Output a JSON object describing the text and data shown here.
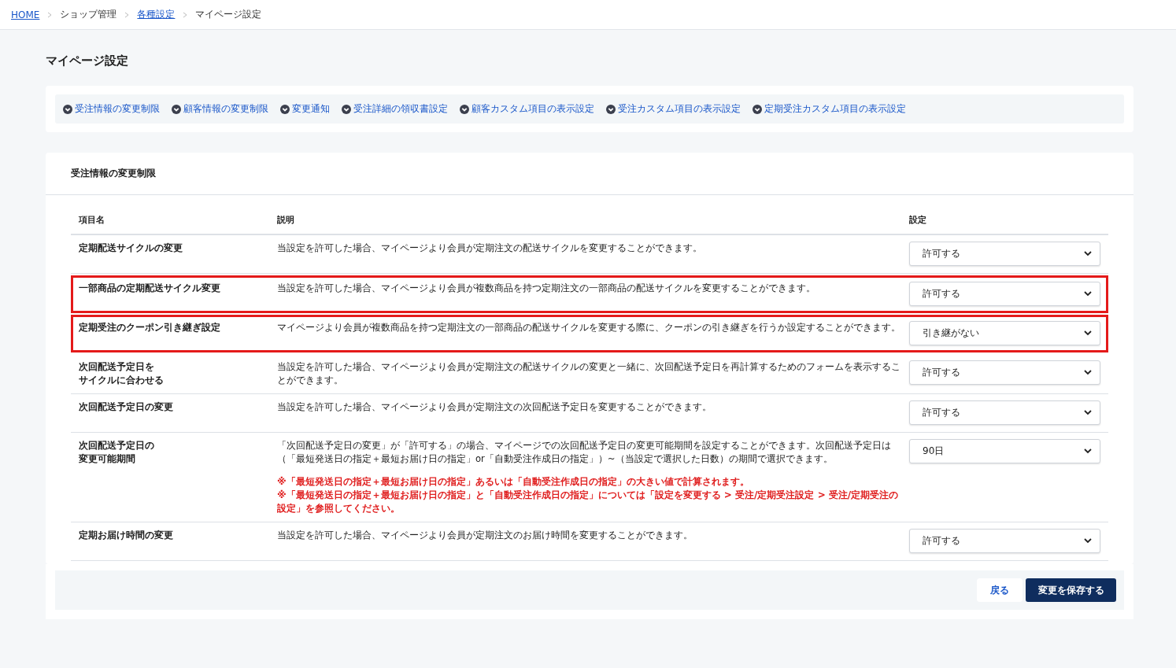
{
  "breadcrumb": [
    {
      "label": "HOME",
      "link": true
    },
    {
      "label": "ショップ管理",
      "link": false
    },
    {
      "label": "各種設定",
      "link": true
    },
    {
      "label": "マイページ設定",
      "link": false
    }
  ],
  "page_title": "マイページ設定",
  "anchor_links": [
    "受注情報の変更制限",
    "顧客情報の変更制限",
    "変更通知",
    "受注詳細の領収書設定",
    "顧客カスタム項目の表示設定",
    "受注カスタム項目の表示設定",
    "定期受注カスタム項目の表示設定"
  ],
  "section": {
    "title": "受注情報の変更制限",
    "columns": [
      "項目名",
      "説明",
      "設定"
    ],
    "rows": [
      {
        "name": "定期配送サイクルの変更",
        "description": "当設定を許可した場合、マイページより会員が定期注文の配送サイクルを変更することができます。",
        "setting": "許可する",
        "highlighted": false
      },
      {
        "name": "一部商品の定期配送サイクル変更",
        "description": "当設定を許可した場合、マイページより会員が複数商品を持つ定期注文の一部商品の配送サイクルを変更することができます。",
        "setting": "許可する",
        "highlighted": true
      },
      {
        "name": "定期受注のクーポン引き継ぎ設定",
        "description": "マイページより会員が複数商品を持つ定期注文の一部商品の配送サイクルを変更する際に、クーポンの引き継ぎを行うか設定することができます。",
        "setting": "引き継がない",
        "highlighted": true
      },
      {
        "name": [
          "次回配送予定日を",
          "サイクルに合わせる"
        ],
        "description": "当設定を許可した場合、マイページより会員が定期注文の配送サイクルの変更と一緒に、次回配送予定日を再計算するためのフォームを表示することができます。",
        "setting": "許可する",
        "highlighted": false
      },
      {
        "name": "次回配送予定日の変更",
        "description": "当設定を許可した場合、マイページより会員が定期注文の次回配送予定日を変更することができます。",
        "setting": "許可する",
        "highlighted": false
      },
      {
        "name": [
          "次回配送予定日の",
          "変更可能期間"
        ],
        "description": "「次回配送予定日の変更」が「許可する」の場合、マイページでの次回配送予定日の変更可能期間を設定することができます。次回配送予定日は（「最短発送日の指定＋最短お届け日の指定」or「自動受注作成日の指定」）~（当設定で選択した日数）の期間で選択できます。",
        "notes": [
          "※「最短発送日の指定＋最短お届け日の指定」あるいは「自動受注作成日の指定」の大きい値で計算されます。",
          "※「最短発送日の指定＋最短お届け日の指定」と「自動受注作成日の指定」については「設定を変更する > 受注/定期受注設定 > 受注/定期受注の設定」を参照してください。"
        ],
        "setting": "90日",
        "highlighted": false
      },
      {
        "name": "定期お届け時間の変更",
        "description": "当設定を許可した場合、マイページより会員が定期注文のお届け時間を変更することができます。",
        "setting": "許可する",
        "highlighted": false
      }
    ]
  },
  "footer": {
    "back_button": "戻る",
    "save_button": "変更を保存する"
  }
}
